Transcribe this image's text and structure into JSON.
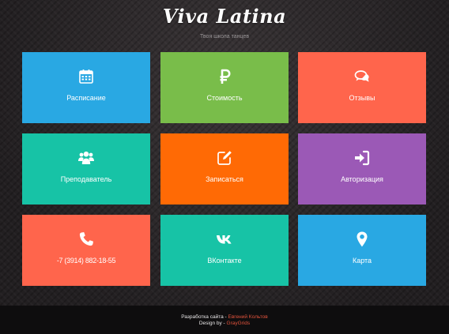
{
  "header": {
    "title": "Viva Latina",
    "subtitle": "Твоя школа танцев"
  },
  "tiles": [
    {
      "label": "Расписание",
      "icon": "calendar-icon",
      "color": "#29A8E3"
    },
    {
      "label": "Стоимость",
      "icon": "ruble-icon",
      "color": "#79BD4A"
    },
    {
      "label": "Отзывы",
      "icon": "comments-icon",
      "color": "#FF654C"
    },
    {
      "label": "Преподаватель",
      "icon": "users-icon",
      "color": "#17C3A6"
    },
    {
      "label": "Записаться",
      "icon": "edit-icon",
      "color": "#FF6A05"
    },
    {
      "label": "Авторизация",
      "icon": "sign-in-icon",
      "color": "#9B59B6"
    },
    {
      "label": "-7 (3914) 882-18-55",
      "icon": "phone-icon",
      "color": "#FF654C"
    },
    {
      "label": "ВКонтакте",
      "icon": "vk-icon",
      "color": "#17C3A6"
    },
    {
      "label": "Карта",
      "icon": "map-marker-icon",
      "color": "#29A8E3"
    }
  ],
  "footer": {
    "dev_prefix": "Разработка сайта - ",
    "dev_name": "Евгений Кольтов",
    "design_prefix": "Design by - ",
    "design_name": "GrayGrids",
    "link_color": "#E2533C",
    "background": "#0E0D0E"
  }
}
